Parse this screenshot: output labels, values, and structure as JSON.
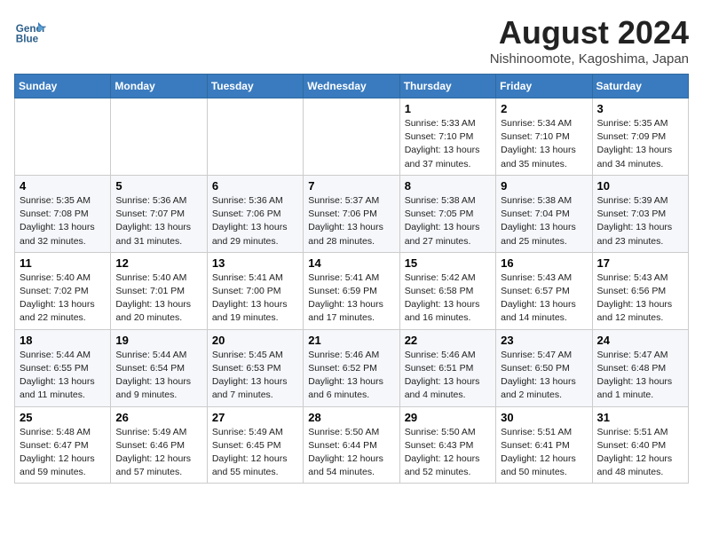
{
  "header": {
    "logo_line1": "General",
    "logo_line2": "Blue",
    "main_title": "August 2024",
    "subtitle": "Nishinoomote, Kagoshima, Japan"
  },
  "days_of_week": [
    "Sunday",
    "Monday",
    "Tuesday",
    "Wednesday",
    "Thursday",
    "Friday",
    "Saturday"
  ],
  "weeks": [
    [
      {
        "day": "",
        "info": ""
      },
      {
        "day": "",
        "info": ""
      },
      {
        "day": "",
        "info": ""
      },
      {
        "day": "",
        "info": ""
      },
      {
        "day": "1",
        "info": "Sunrise: 5:33 AM\nSunset: 7:10 PM\nDaylight: 13 hours\nand 37 minutes."
      },
      {
        "day": "2",
        "info": "Sunrise: 5:34 AM\nSunset: 7:10 PM\nDaylight: 13 hours\nand 35 minutes."
      },
      {
        "day": "3",
        "info": "Sunrise: 5:35 AM\nSunset: 7:09 PM\nDaylight: 13 hours\nand 34 minutes."
      }
    ],
    [
      {
        "day": "4",
        "info": "Sunrise: 5:35 AM\nSunset: 7:08 PM\nDaylight: 13 hours\nand 32 minutes."
      },
      {
        "day": "5",
        "info": "Sunrise: 5:36 AM\nSunset: 7:07 PM\nDaylight: 13 hours\nand 31 minutes."
      },
      {
        "day": "6",
        "info": "Sunrise: 5:36 AM\nSunset: 7:06 PM\nDaylight: 13 hours\nand 29 minutes."
      },
      {
        "day": "7",
        "info": "Sunrise: 5:37 AM\nSunset: 7:06 PM\nDaylight: 13 hours\nand 28 minutes."
      },
      {
        "day": "8",
        "info": "Sunrise: 5:38 AM\nSunset: 7:05 PM\nDaylight: 13 hours\nand 27 minutes."
      },
      {
        "day": "9",
        "info": "Sunrise: 5:38 AM\nSunset: 7:04 PM\nDaylight: 13 hours\nand 25 minutes."
      },
      {
        "day": "10",
        "info": "Sunrise: 5:39 AM\nSunset: 7:03 PM\nDaylight: 13 hours\nand 23 minutes."
      }
    ],
    [
      {
        "day": "11",
        "info": "Sunrise: 5:40 AM\nSunset: 7:02 PM\nDaylight: 13 hours\nand 22 minutes."
      },
      {
        "day": "12",
        "info": "Sunrise: 5:40 AM\nSunset: 7:01 PM\nDaylight: 13 hours\nand 20 minutes."
      },
      {
        "day": "13",
        "info": "Sunrise: 5:41 AM\nSunset: 7:00 PM\nDaylight: 13 hours\nand 19 minutes."
      },
      {
        "day": "14",
        "info": "Sunrise: 5:41 AM\nSunset: 6:59 PM\nDaylight: 13 hours\nand 17 minutes."
      },
      {
        "day": "15",
        "info": "Sunrise: 5:42 AM\nSunset: 6:58 PM\nDaylight: 13 hours\nand 16 minutes."
      },
      {
        "day": "16",
        "info": "Sunrise: 5:43 AM\nSunset: 6:57 PM\nDaylight: 13 hours\nand 14 minutes."
      },
      {
        "day": "17",
        "info": "Sunrise: 5:43 AM\nSunset: 6:56 PM\nDaylight: 13 hours\nand 12 minutes."
      }
    ],
    [
      {
        "day": "18",
        "info": "Sunrise: 5:44 AM\nSunset: 6:55 PM\nDaylight: 13 hours\nand 11 minutes."
      },
      {
        "day": "19",
        "info": "Sunrise: 5:44 AM\nSunset: 6:54 PM\nDaylight: 13 hours\nand 9 minutes."
      },
      {
        "day": "20",
        "info": "Sunrise: 5:45 AM\nSunset: 6:53 PM\nDaylight: 13 hours\nand 7 minutes."
      },
      {
        "day": "21",
        "info": "Sunrise: 5:46 AM\nSunset: 6:52 PM\nDaylight: 13 hours\nand 6 minutes."
      },
      {
        "day": "22",
        "info": "Sunrise: 5:46 AM\nSunset: 6:51 PM\nDaylight: 13 hours\nand 4 minutes."
      },
      {
        "day": "23",
        "info": "Sunrise: 5:47 AM\nSunset: 6:50 PM\nDaylight: 13 hours\nand 2 minutes."
      },
      {
        "day": "24",
        "info": "Sunrise: 5:47 AM\nSunset: 6:48 PM\nDaylight: 13 hours\nand 1 minute."
      }
    ],
    [
      {
        "day": "25",
        "info": "Sunrise: 5:48 AM\nSunset: 6:47 PM\nDaylight: 12 hours\nand 59 minutes."
      },
      {
        "day": "26",
        "info": "Sunrise: 5:49 AM\nSunset: 6:46 PM\nDaylight: 12 hours\nand 57 minutes."
      },
      {
        "day": "27",
        "info": "Sunrise: 5:49 AM\nSunset: 6:45 PM\nDaylight: 12 hours\nand 55 minutes."
      },
      {
        "day": "28",
        "info": "Sunrise: 5:50 AM\nSunset: 6:44 PM\nDaylight: 12 hours\nand 54 minutes."
      },
      {
        "day": "29",
        "info": "Sunrise: 5:50 AM\nSunset: 6:43 PM\nDaylight: 12 hours\nand 52 minutes."
      },
      {
        "day": "30",
        "info": "Sunrise: 5:51 AM\nSunset: 6:41 PM\nDaylight: 12 hours\nand 50 minutes."
      },
      {
        "day": "31",
        "info": "Sunrise: 5:51 AM\nSunset: 6:40 PM\nDaylight: 12 hours\nand 48 minutes."
      }
    ]
  ]
}
